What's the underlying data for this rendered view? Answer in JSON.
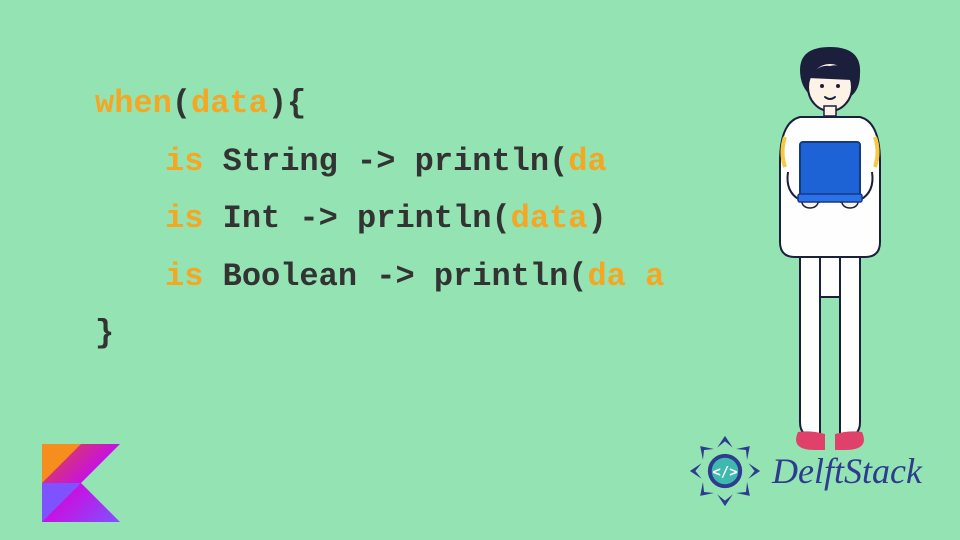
{
  "code": {
    "line1": {
      "when": "when",
      "paren_open": "(",
      "arg": "data",
      "paren_close": "){"
    },
    "line2": {
      "is": "is",
      "type": "String",
      "arrow": " -> ",
      "fn": "println(",
      "arg": "da",
      "close": ""
    },
    "line3": {
      "is": "is",
      "type": "Int",
      "arrow": " -> ",
      "fn": "println(",
      "arg": "data",
      "close": ")"
    },
    "line4": {
      "is": "is",
      "type": "Boolean",
      "arrow": " -> ",
      "fn": "println(",
      "arg": "da a",
      "close": ""
    },
    "line5": {
      "brace": "}"
    }
  },
  "brand": {
    "name": "DelftStack"
  },
  "colors": {
    "background": "#93e4b2",
    "keyword_orange": "#f5a623",
    "text_dark": "#333333",
    "brand_blue": "#2e3b8f",
    "kotlin_orange": "#f68e1e",
    "kotlin_purple": "#7f52ff",
    "laptop_blue": "#1e63d6",
    "shoes_pink": "#e0416a"
  }
}
